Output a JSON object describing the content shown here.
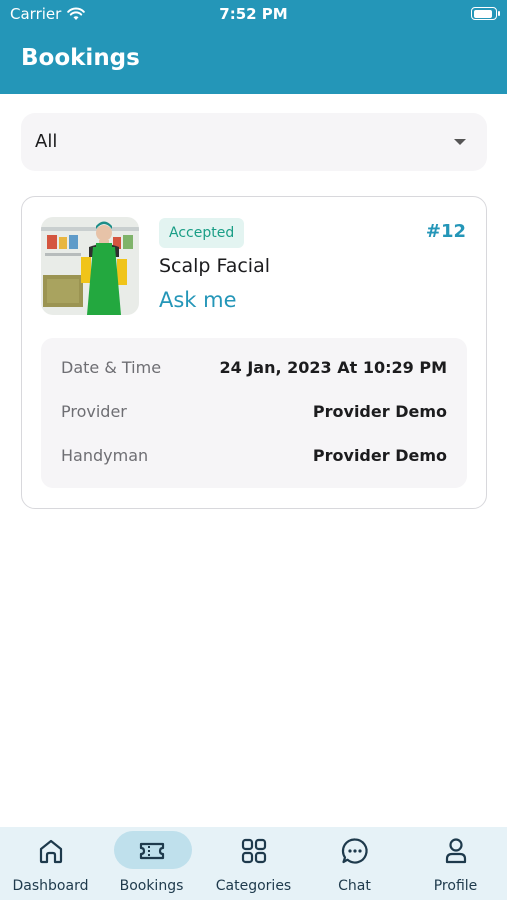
{
  "status_bar": {
    "carrier": "Carrier",
    "time": "7:52 PM",
    "battery_level": 0.9
  },
  "header": {
    "title": "Bookings"
  },
  "filter": {
    "selected": "All"
  },
  "booking": {
    "status": "Accepted",
    "id": "#12",
    "service": "Scalp Facial",
    "price": "Ask me",
    "details": [
      {
        "label": "Date & Time",
        "value": "24 Jan, 2023 At 10:29 PM"
      },
      {
        "label": "Provider",
        "value": "Provider Demo"
      },
      {
        "label": "Handyman",
        "value": "Provider Demo"
      }
    ]
  },
  "nav": {
    "items": [
      {
        "label": "Dashboard",
        "icon": "home-icon"
      },
      {
        "label": "Bookings",
        "icon": "ticket-icon",
        "active": true
      },
      {
        "label": "Categories",
        "icon": "grid-icon"
      },
      {
        "label": "Chat",
        "icon": "chat-icon"
      },
      {
        "label": "Profile",
        "icon": "profile-icon"
      }
    ]
  },
  "colors": {
    "primary": "#2496b8",
    "badge_bg": "#e3f4f1",
    "badge_text": "#1a9e86",
    "nav_bg": "#e6f2f7",
    "nav_pill": "#bfe0ec"
  }
}
